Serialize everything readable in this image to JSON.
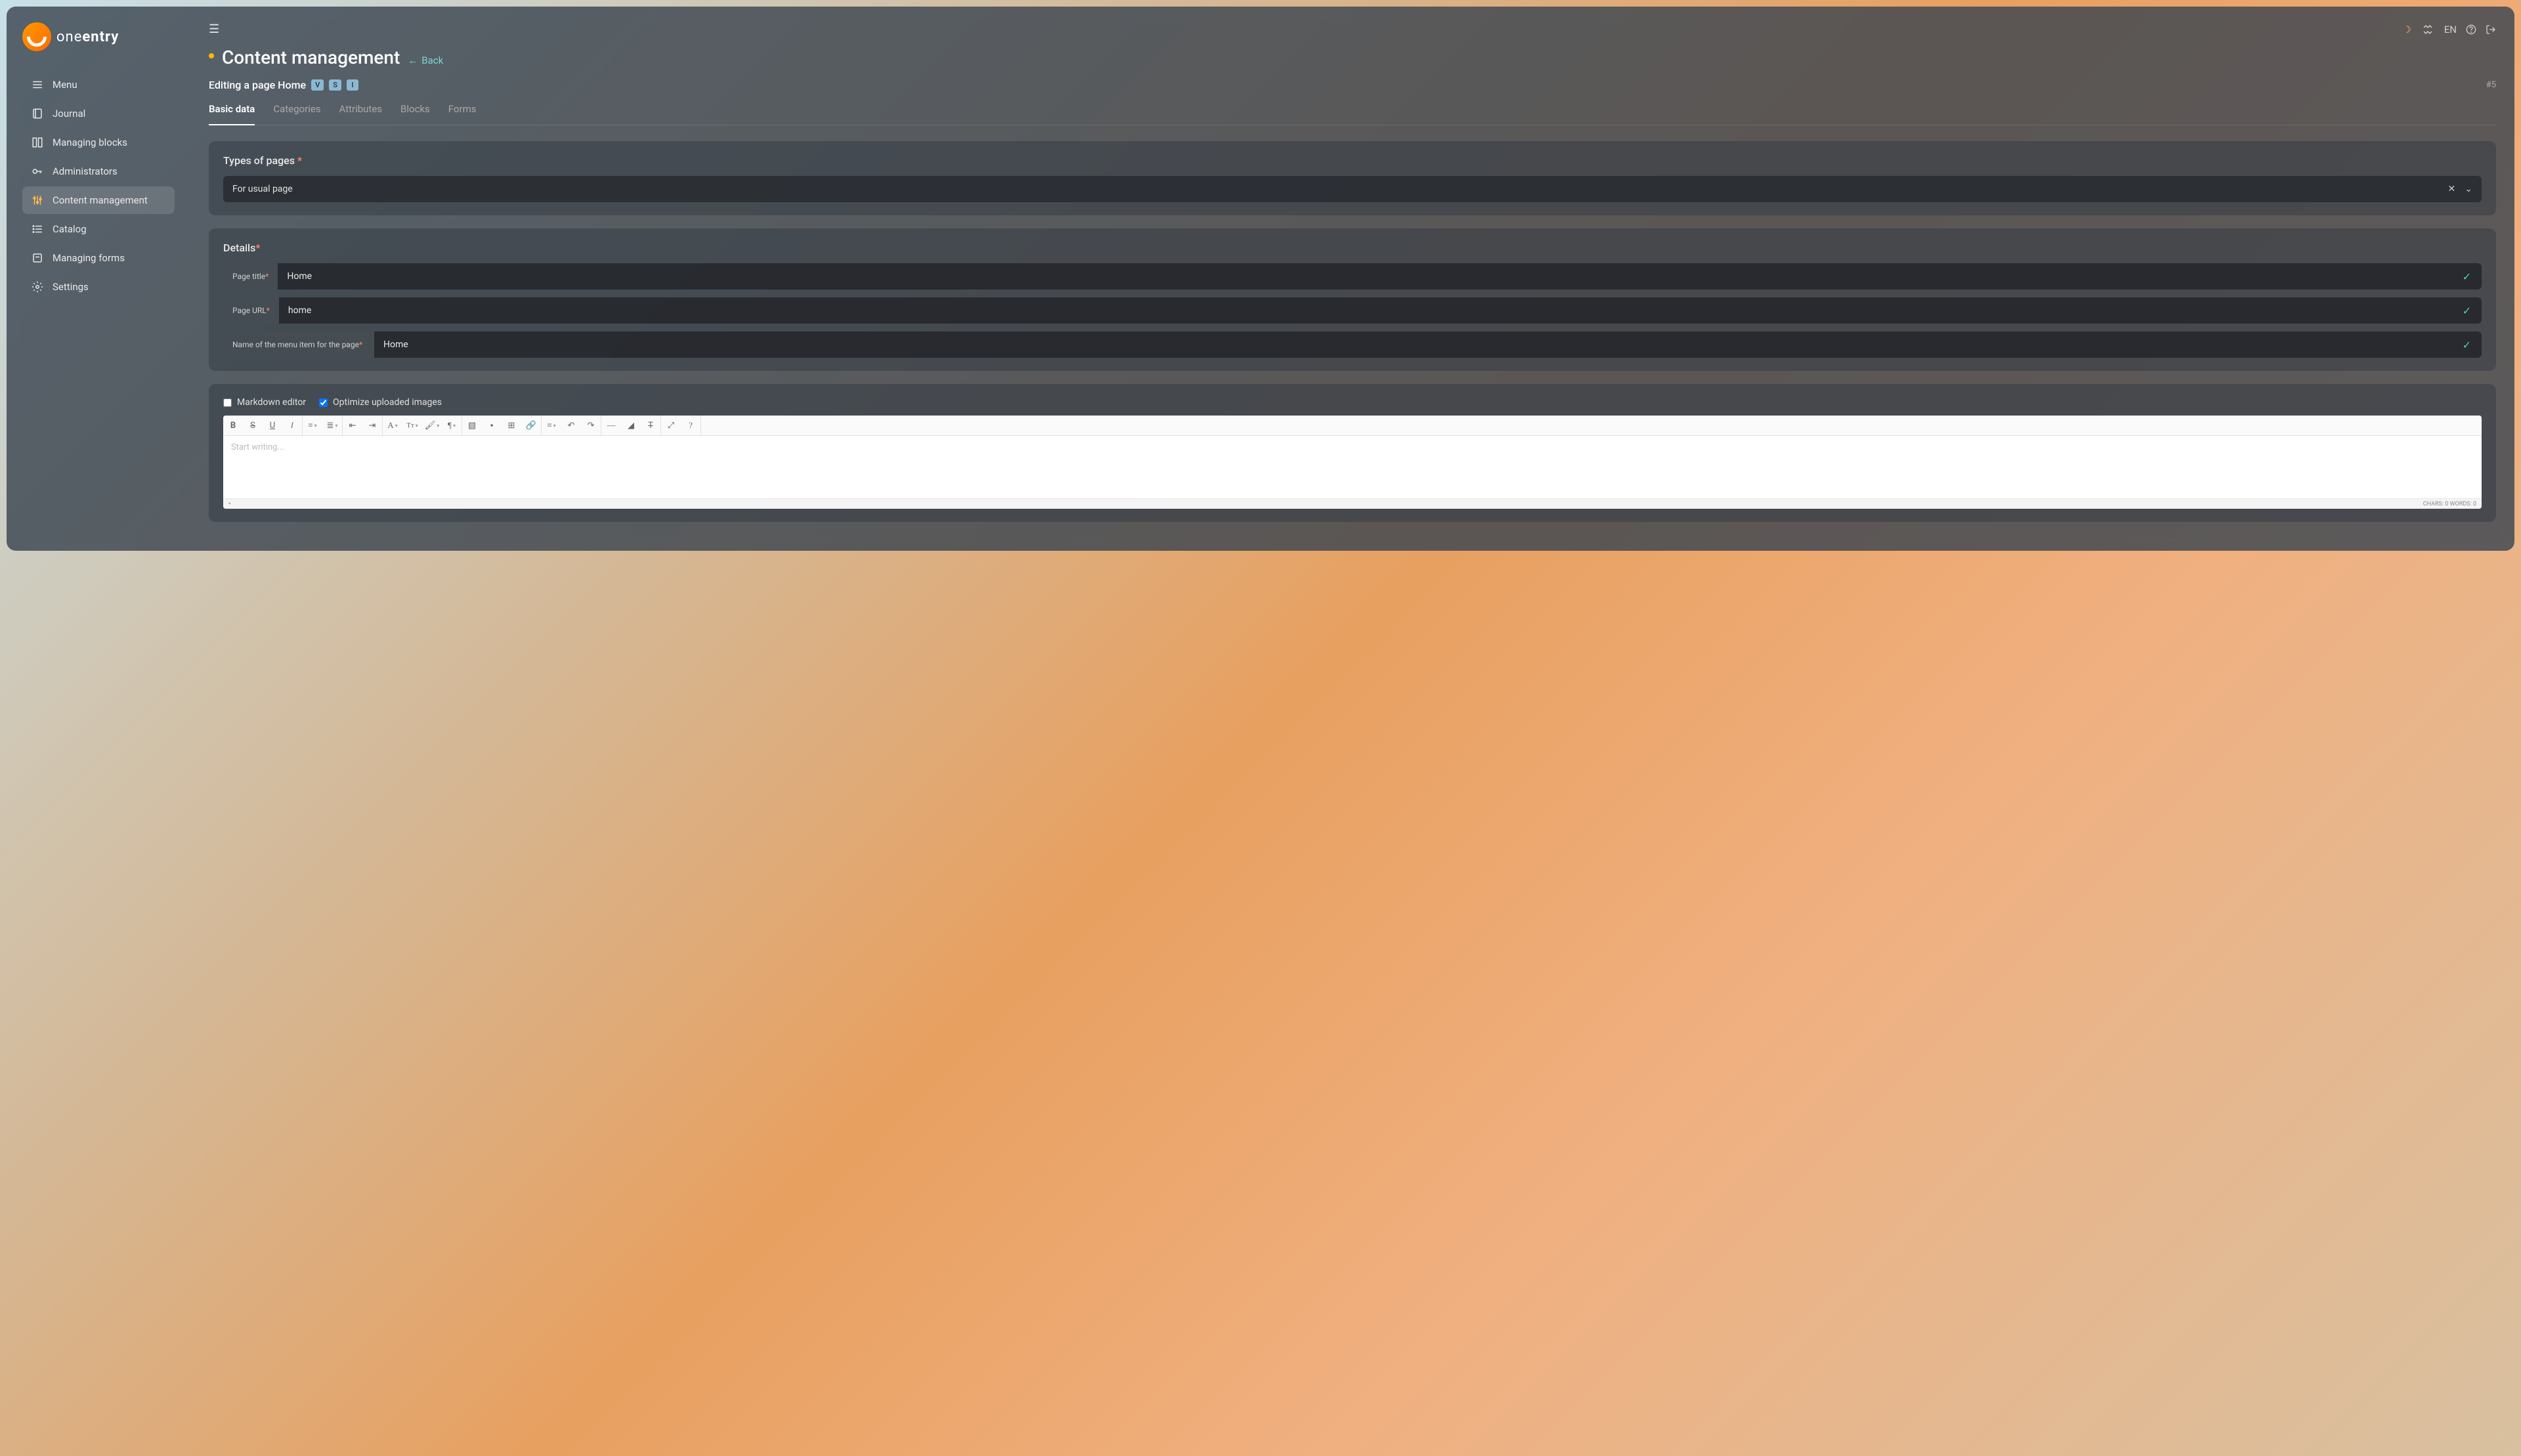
{
  "brand": {
    "text_a": "one",
    "text_b": "entry"
  },
  "sidebar": {
    "items": [
      {
        "label": "Menu"
      },
      {
        "label": "Journal"
      },
      {
        "label": "Managing blocks"
      },
      {
        "label": "Administrators"
      },
      {
        "label": "Content management"
      },
      {
        "label": "Catalog"
      },
      {
        "label": "Managing forms"
      },
      {
        "label": "Settings"
      }
    ]
  },
  "header": {
    "title": "Content management",
    "back": "Back",
    "lang": "EN"
  },
  "subheader": {
    "text": "Editing a page Home",
    "badges": [
      "V",
      "S",
      "I"
    ],
    "id": "#5"
  },
  "tabs": [
    "Basic data",
    "Categories",
    "Attributes",
    "Blocks",
    "Forms"
  ],
  "types": {
    "label": "Types of pages",
    "value": "For usual page"
  },
  "details": {
    "label": "Details",
    "fields": [
      {
        "label": "Page title",
        "value": "Home"
      },
      {
        "label": "Page URL",
        "value": "home"
      },
      {
        "label": "Name of the menu item for the page",
        "value": "Home"
      }
    ]
  },
  "editor": {
    "markdown": "Markdown editor",
    "optimize": "Optimize uploaded images",
    "placeholder": "Start writing...",
    "stats": "CHARS: 0   WORDS: 0"
  }
}
